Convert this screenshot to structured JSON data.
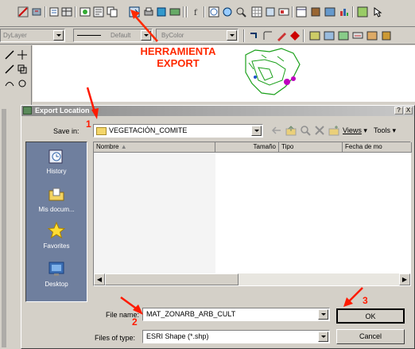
{
  "toolbar": {
    "layer_combo": "DyLayer",
    "linetype_combo": "Default",
    "color_combo": "ByColor"
  },
  "annotation": {
    "tool_label": "HERRAMIENTA\nEXPORT",
    "step1": "1",
    "step2": "2",
    "step3": "3"
  },
  "dialog": {
    "title": "Export Location",
    "help": "?",
    "close": "X",
    "save_in_label": "Save in:",
    "save_in_value": "VEGETACIÓN_COMITE",
    "views_label": "Views",
    "tools_label": "Tools",
    "columns": [
      "Nombre",
      "Tamaño",
      "Tipo",
      "Fecha de mo"
    ],
    "places": [
      "History",
      "Mis docum...",
      "Favorites",
      "Desktop"
    ],
    "file_name_label": "File name:",
    "file_name_value": "MAT_ZONARB_ARB_CULT",
    "file_type_label": "Files of type:",
    "file_type_value": "ESRI Shape (*.shp)",
    "ok_label": "OK",
    "cancel_label": "Cancel"
  },
  "colors": {
    "annotation_red": "#ff2a00",
    "places_bar": "#6f7f9e",
    "title_bar": "#b5b5b5"
  }
}
